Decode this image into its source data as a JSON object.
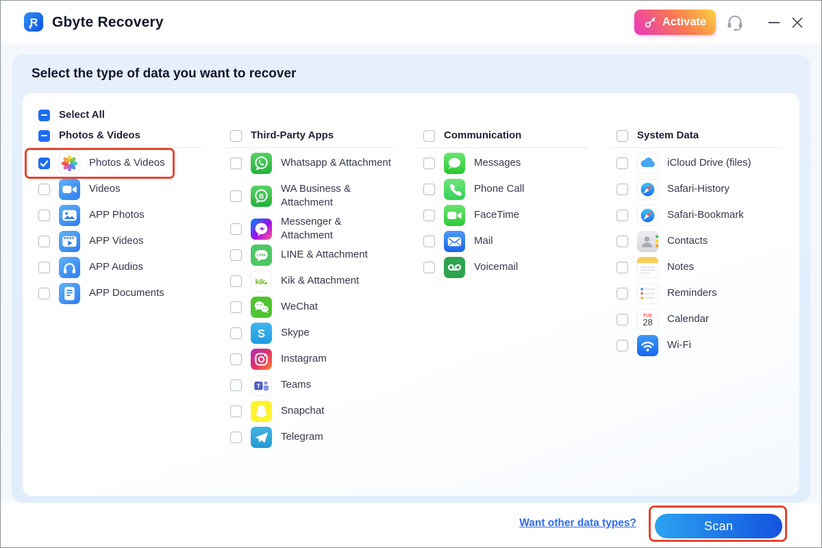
{
  "app": {
    "title": "Gbyte Recovery"
  },
  "topbar": {
    "activate_label": "Activate"
  },
  "panel": {
    "heading": "Select the type of data you want to recover"
  },
  "select_all": {
    "label": "Select All",
    "checkbox": "indeterminate"
  },
  "columns": [
    {
      "header": {
        "label": "Photos & Videos",
        "checkbox": "indeterminate"
      },
      "items": [
        {
          "label": "Photos & Videos",
          "icon": "photos-icon",
          "checkbox": "checked",
          "highlighted": true
        },
        {
          "label": "Videos",
          "icon": "videos-icon",
          "checkbox": "unchecked"
        },
        {
          "label": "APP Photos",
          "icon": "app-photos-icon",
          "checkbox": "unchecked"
        },
        {
          "label": "APP Videos",
          "icon": "app-videos-icon",
          "checkbox": "unchecked"
        },
        {
          "label": "APP Audios",
          "icon": "app-audios-icon",
          "checkbox": "unchecked"
        },
        {
          "label": "APP Documents",
          "icon": "app-documents-icon",
          "checkbox": "unchecked"
        }
      ]
    },
    {
      "header": {
        "label": "Third-Party Apps",
        "checkbox": "unchecked"
      },
      "items": [
        {
          "label": "Whatsapp & Attachment",
          "icon": "whatsapp-icon",
          "checkbox": "unchecked"
        },
        {
          "label": "WA Business &\nAttachment",
          "icon": "wa-business-icon",
          "checkbox": "unchecked"
        },
        {
          "label": "Messenger & Attachment",
          "icon": "messenger-icon",
          "checkbox": "unchecked"
        },
        {
          "label": "LINE & Attachment",
          "icon": "line-icon",
          "checkbox": "unchecked"
        },
        {
          "label": "Kik & Attachment",
          "icon": "kik-icon",
          "checkbox": "unchecked"
        },
        {
          "label": "WeChat",
          "icon": "wechat-icon",
          "checkbox": "unchecked"
        },
        {
          "label": "Skype",
          "icon": "skype-icon",
          "checkbox": "unchecked"
        },
        {
          "label": "Instagram",
          "icon": "instagram-icon",
          "checkbox": "unchecked"
        },
        {
          "label": "Teams",
          "icon": "teams-icon",
          "checkbox": "unchecked"
        },
        {
          "label": "Snapchat",
          "icon": "snapchat-icon",
          "checkbox": "unchecked"
        },
        {
          "label": "Telegram",
          "icon": "telegram-icon",
          "checkbox": "unchecked"
        }
      ]
    },
    {
      "header": {
        "label": "Communication",
        "checkbox": "unchecked"
      },
      "items": [
        {
          "label": "Messages",
          "icon": "messages-icon",
          "checkbox": "unchecked"
        },
        {
          "label": "Phone Call",
          "icon": "phone-call-icon",
          "checkbox": "unchecked"
        },
        {
          "label": "FaceTime",
          "icon": "facetime-icon",
          "checkbox": "unchecked"
        },
        {
          "label": "Mail",
          "icon": "mail-icon",
          "checkbox": "unchecked"
        },
        {
          "label": "Voicemail",
          "icon": "voicemail-icon",
          "checkbox": "unchecked"
        }
      ]
    },
    {
      "header": {
        "label": "System Data",
        "checkbox": "unchecked"
      },
      "items": [
        {
          "label": "iCloud Drive (files)",
          "icon": "icloud-icon",
          "checkbox": "unchecked"
        },
        {
          "label": "Safari-History",
          "icon": "safari-icon",
          "checkbox": "unchecked"
        },
        {
          "label": "Safari-Bookmark",
          "icon": "safari-icon",
          "checkbox": "unchecked"
        },
        {
          "label": "Contacts",
          "icon": "contacts-icon",
          "checkbox": "unchecked"
        },
        {
          "label": "Notes",
          "icon": "notes-icon",
          "checkbox": "unchecked"
        },
        {
          "label": "Reminders",
          "icon": "reminders-icon",
          "checkbox": "unchecked"
        },
        {
          "label": "Calendar",
          "icon": "calendar-icon",
          "checkbox": "unchecked",
          "icon_text": {
            "weekday": "TUE",
            "day": "28"
          }
        },
        {
          "label": "Wi-Fi",
          "icon": "wifi-icon",
          "checkbox": "unchecked"
        }
      ]
    }
  ],
  "footer": {
    "link_label": "Want other data types?",
    "scan_label": "Scan"
  },
  "colors": {
    "accent_blue": "#1C6CF2",
    "highlight_red": "#E8432D",
    "link_blue": "#2F6BF2",
    "scan_gradient_start": "#2BA3F1",
    "scan_gradient_end": "#1453DE",
    "activate_gradient_start": "#E935BE",
    "activate_gradient_end": "#FDD23E",
    "panel_blue": "#E0EDFB"
  }
}
